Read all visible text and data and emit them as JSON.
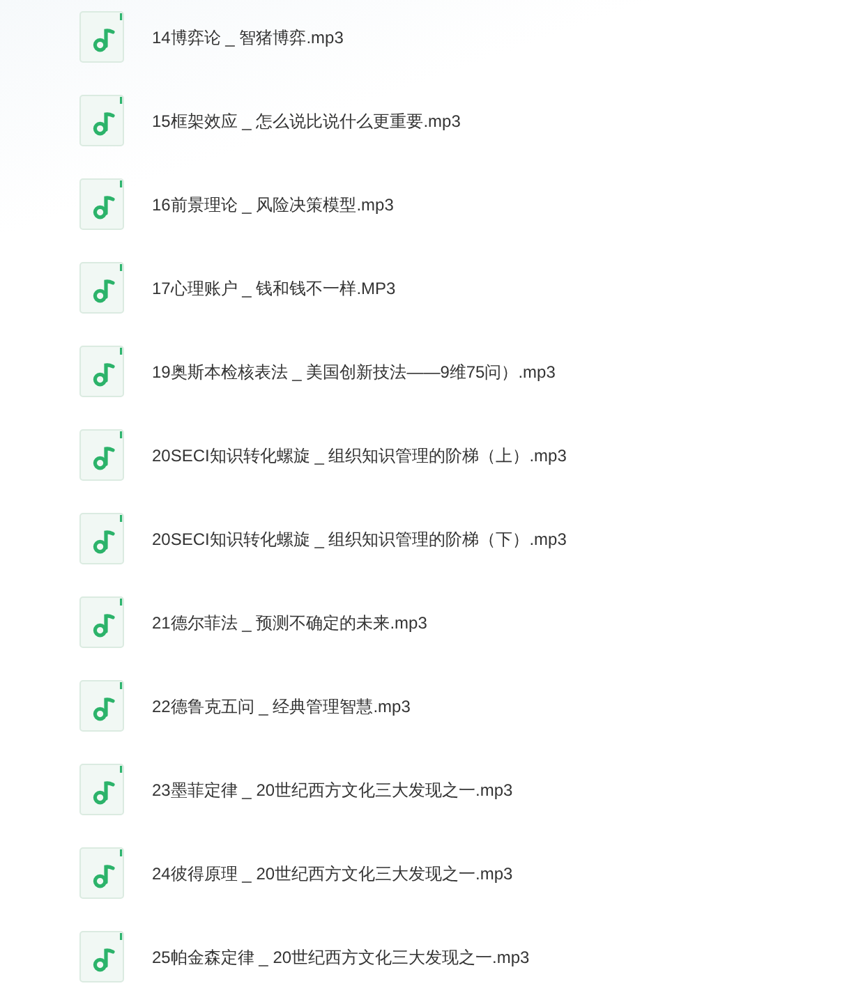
{
  "files": [
    {
      "name": "14博弈论 _ 智猪博弈.mp3"
    },
    {
      "name": "15框架效应 _ 怎么说比说什么更重要.mp3"
    },
    {
      "name": "16前景理论 _ 风险决策模型.mp3"
    },
    {
      "name": "17心理账户 _ 钱和钱不一样.MP3"
    },
    {
      "name": "19奥斯本检核表法 _ 美国创新技法——9维75问）.mp3"
    },
    {
      "name": "20SECI知识转化螺旋 _ 组织知识管理的阶梯（上）.mp3"
    },
    {
      "name": "20SECI知识转化螺旋 _ 组织知识管理的阶梯（下）.mp3"
    },
    {
      "name": "21德尔菲法 _ 预测不确定的未来.mp3"
    },
    {
      "name": "22德鲁克五问 _ 经典管理智慧.mp3"
    },
    {
      "name": "23墨菲定律 _ 20世纪西方文化三大发现之一.mp3"
    },
    {
      "name": "24彼得原理 _ 20世纪西方文化三大发现之一.mp3"
    },
    {
      "name": "25帕金森定律 _ 20世纪西方文化三大发现之一.mp3"
    }
  ]
}
